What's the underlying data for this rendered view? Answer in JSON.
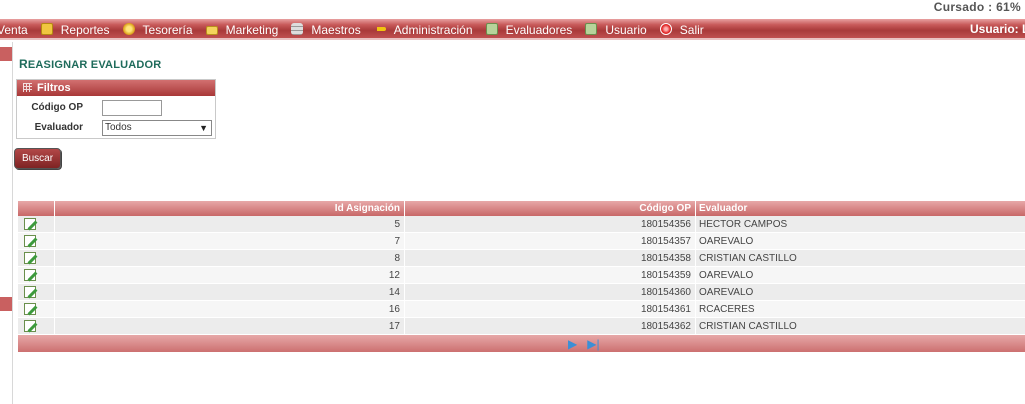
{
  "header": {
    "cursado": "Cursado : 61%"
  },
  "menu": {
    "items": [
      {
        "label": "Venta",
        "icon": ""
      },
      {
        "label": "Reportes",
        "icon": "report-icon"
      },
      {
        "label": "Tesorería",
        "icon": "coin-icon"
      },
      {
        "label": "Marketing",
        "icon": "folder-icon"
      },
      {
        "label": "Maestros",
        "icon": "database-icon"
      },
      {
        "label": "Administración",
        "icon": "key-icon"
      },
      {
        "label": "Evaluadores",
        "icon": "document-icon"
      },
      {
        "label": "Usuario",
        "icon": "document-icon"
      },
      {
        "label": "Salir",
        "icon": "exit-icon"
      }
    ],
    "usuario_label": "Usuario: L"
  },
  "page": {
    "title_first": "R",
    "title_rest": "EASIGNAR EVALUADOR"
  },
  "filtros": {
    "title": "Filtros",
    "codigo_label": "Código OP",
    "codigo_value": "",
    "evaluador_label": "Evaluador",
    "evaluador_value": "Todos"
  },
  "buscar_label": "Buscar",
  "grid": {
    "columns": [
      "",
      "Id Asignación",
      "Código OP",
      "Evaluador"
    ],
    "rows": [
      {
        "id": "5",
        "codigo": "180154356",
        "evaluador": "HECTOR CAMPOS"
      },
      {
        "id": "7",
        "codigo": "180154357",
        "evaluador": "OAREVALO"
      },
      {
        "id": "8",
        "codigo": "180154358",
        "evaluador": "CRISTIAN CASTILLO"
      },
      {
        "id": "12",
        "codigo": "180154359",
        "evaluador": "OAREVALO"
      },
      {
        "id": "14",
        "codigo": "180154360",
        "evaluador": "OAREVALO"
      },
      {
        "id": "16",
        "codigo": "180154361",
        "evaluador": "RCACERES"
      },
      {
        "id": "17",
        "codigo": "180154362",
        "evaluador": "CRISTIAN CASTILLO"
      }
    ],
    "pager": {
      "next": "▶",
      "last": "▶|"
    }
  },
  "colors": {
    "accent": "#a93a3a",
    "title": "#1e6b5b",
    "pager": "#3b8fd6"
  }
}
